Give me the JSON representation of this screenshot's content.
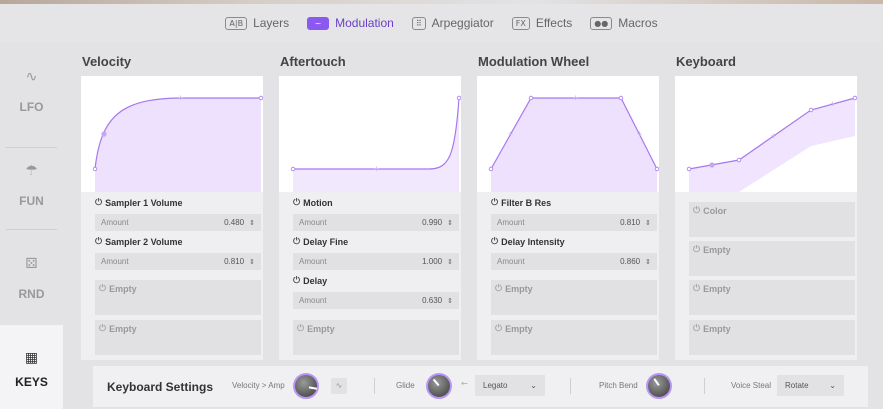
{
  "tabs": [
    {
      "icon": "A|B",
      "icon_name": "layers-icon",
      "label": "Layers",
      "active": false
    },
    {
      "icon": "~",
      "icon_name": "modulation-icon",
      "label": "Modulation",
      "active": true
    },
    {
      "icon": "⠿",
      "icon_name": "arpeggiator-icon",
      "label": "Arpeggiator",
      "active": false
    },
    {
      "icon": "FX",
      "icon_name": "effects-icon",
      "label": "Effects",
      "active": false
    },
    {
      "icon": "●●",
      "icon_name": "macros-icon",
      "label": "Macros",
      "active": false
    }
  ],
  "sidebar": {
    "items": [
      {
        "icon": "∿",
        "icon_name": "lfo-icon",
        "label": "LFO"
      },
      {
        "icon": "☂",
        "icon_name": "fun-icon",
        "label": "FUN"
      },
      {
        "icon": "⚄",
        "icon_name": "dice-icon",
        "label": "RND"
      },
      {
        "icon": "▦",
        "icon_name": "keyboard-icon",
        "label": "KEYS"
      }
    ]
  },
  "columns": [
    {
      "title": "Velocity",
      "slots": [
        {
          "name": "Sampler 1 Volume",
          "param": "Amount",
          "value": "0.480",
          "empty": false
        },
        {
          "name": "Sampler 2 Volume",
          "param": "Amount",
          "value": "0.810",
          "empty": false
        },
        {
          "name": "Empty",
          "empty": true
        },
        {
          "name": "Empty",
          "empty": true
        }
      ]
    },
    {
      "title": "Aftertouch",
      "slots": [
        {
          "name": "Motion",
          "param": "Amount",
          "value": "0.990",
          "empty": false
        },
        {
          "name": "Delay Fine",
          "param": "Amount",
          "value": "1.000",
          "empty": false
        },
        {
          "name": "Delay",
          "param": "Amount",
          "value": "0.630",
          "empty": false
        },
        {
          "name": "Empty",
          "empty": true
        }
      ]
    },
    {
      "title": "Modulation Wheel",
      "slots": [
        {
          "name": "Filter B Res",
          "param": "Amount",
          "value": "0.810",
          "empty": false
        },
        {
          "name": "Delay Intensity",
          "param": "Amount",
          "value": "0.860",
          "empty": false
        },
        {
          "name": "Empty",
          "empty": true
        },
        {
          "name": "Empty",
          "empty": true
        }
      ]
    },
    {
      "title": "Keyboard",
      "slots": [
        {
          "name": "Color",
          "empty": true
        },
        {
          "name": "Empty",
          "empty": true
        },
        {
          "name": "Empty",
          "empty": true
        },
        {
          "name": "Empty",
          "empty": true
        }
      ]
    }
  ],
  "footer": {
    "title": "Keyboard Settings",
    "velocity_amp_label": "Velocity > Amp",
    "glide_label": "Glide",
    "glide_mode": "Legato",
    "pitch_bend_label": "Pitch Bend",
    "voice_steal_label": "Voice Steal",
    "voice_steal_value": "Rotate"
  },
  "colors": {
    "accent": "#8b58f0",
    "curve": "#a678f0",
    "fill": "#e6d6fb"
  }
}
